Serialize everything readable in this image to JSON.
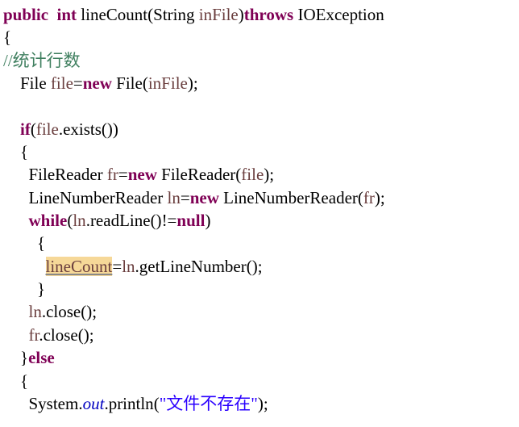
{
  "tokens": {
    "kw_public": "public",
    "kw_int": "int",
    "method_name": "lineCount",
    "lparen": "(",
    "type_string": "String",
    "param_infile": "inFile",
    "rparen": ")",
    "kw_throws": "throws",
    "type_ioexception": "IOException",
    "lbrace": "{",
    "comment_line": "//统计行数",
    "type_file": "File",
    "var_file": "file",
    "eq": "=",
    "kw_new": "new",
    "semi": ";",
    "kw_if": "if",
    "dot": ".",
    "m_exists": "exists",
    "parens_empty": "()",
    "type_filereader": "FileReader",
    "var_fr": "fr",
    "type_linenumberreader": "LineNumberReader",
    "var_ln": "ln",
    "kw_while": "while",
    "m_readline": "readLine",
    "neq": "!=",
    "kw_null": "null",
    "var_linecount": "lineCount",
    "m_getlinenumber": "getLineNumber",
    "rbrace": "}",
    "m_close": "close",
    "kw_else": "else",
    "type_system": "System",
    "field_out": "out",
    "m_println": "println",
    "str_nofile": "\"文件不存在\"",
    "sp": " ",
    "sp2": "  ",
    "ind1": "    ",
    "ind2": "      ",
    "ind3": "        ",
    "ind4": "          "
  }
}
